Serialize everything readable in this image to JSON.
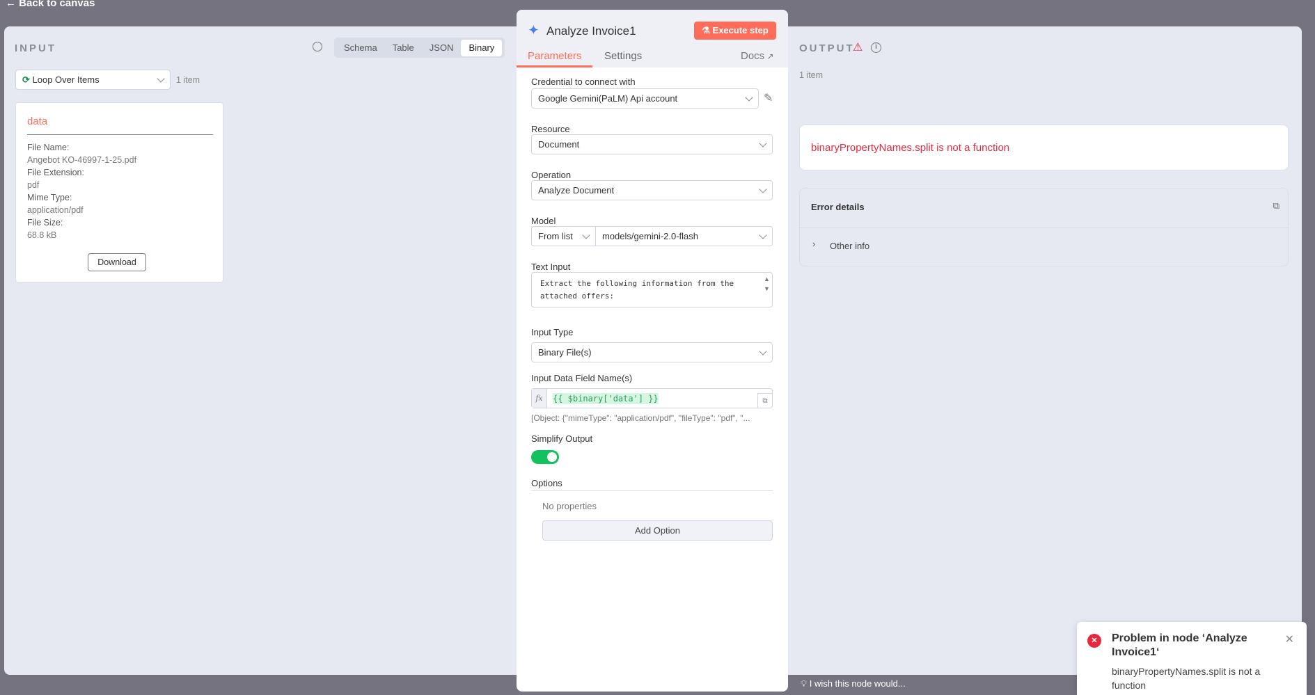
{
  "nav": {
    "back_label": "Back to canvas"
  },
  "input": {
    "title": "INPUT",
    "tabs": [
      "Schema",
      "Table",
      "JSON",
      "Binary"
    ],
    "active_tab": "Binary",
    "source_node": "Loop Over Items",
    "item_count": "1 item",
    "card": {
      "title": "data",
      "fields": [
        {
          "key": "File Name:",
          "value": "Angebot KO-46997-1-25.pdf"
        },
        {
          "key": "File Extension:",
          "value": "pdf"
        },
        {
          "key": "Mime Type:",
          "value": "application/pdf"
        },
        {
          "key": "File Size:",
          "value": "68.8 kB"
        }
      ],
      "download_label": "Download"
    }
  },
  "node": {
    "title": "Analyze Invoice1",
    "execute_label": "Execute step",
    "tabs": [
      "Parameters",
      "Settings"
    ],
    "docs_label": "Docs",
    "credential_label": "Credential to connect with",
    "credential_value": "Google Gemini(PaLM) Api account",
    "resource_label": "Resource",
    "resource_value": "Document",
    "operation_label": "Operation",
    "operation_value": "Analyze Document",
    "model_label": "Model",
    "model_mode": "From list",
    "model_value": "models/gemini-2.0-flash",
    "text_input_label": "Text Input",
    "text_input_value": "Extract the following information from the attached offers:",
    "input_type_label": "Input Type",
    "input_type_value": "Binary File(s)",
    "field_names_label": "Input Data Field Name(s)",
    "field_names_value": "{{ $binary['data'] }}",
    "field_names_hint": "[Object: {\"mimeType\": \"application/pdf\", \"fileType\": \"pdf\", \"...",
    "simplify_label": "Simplify Output",
    "simplify_on": true,
    "options_label": "Options",
    "no_properties": "No properties",
    "add_option_label": "Add Option"
  },
  "output": {
    "title": "OUTPUT",
    "item_count": "1 item",
    "error_message": "binaryPropertyNames.split is not a function",
    "error_details_label": "Error details",
    "other_info_label": "Other info"
  },
  "feedback": {
    "label": "I wish this node would..."
  },
  "toast": {
    "title": "Problem in node ‘Analyze Invoice1‘",
    "message": "binaryPropertyNames.split is not a function"
  },
  "colors": {
    "accent": "#ff6d5a",
    "error": "#e8283e",
    "toggle": "#13c15f"
  }
}
